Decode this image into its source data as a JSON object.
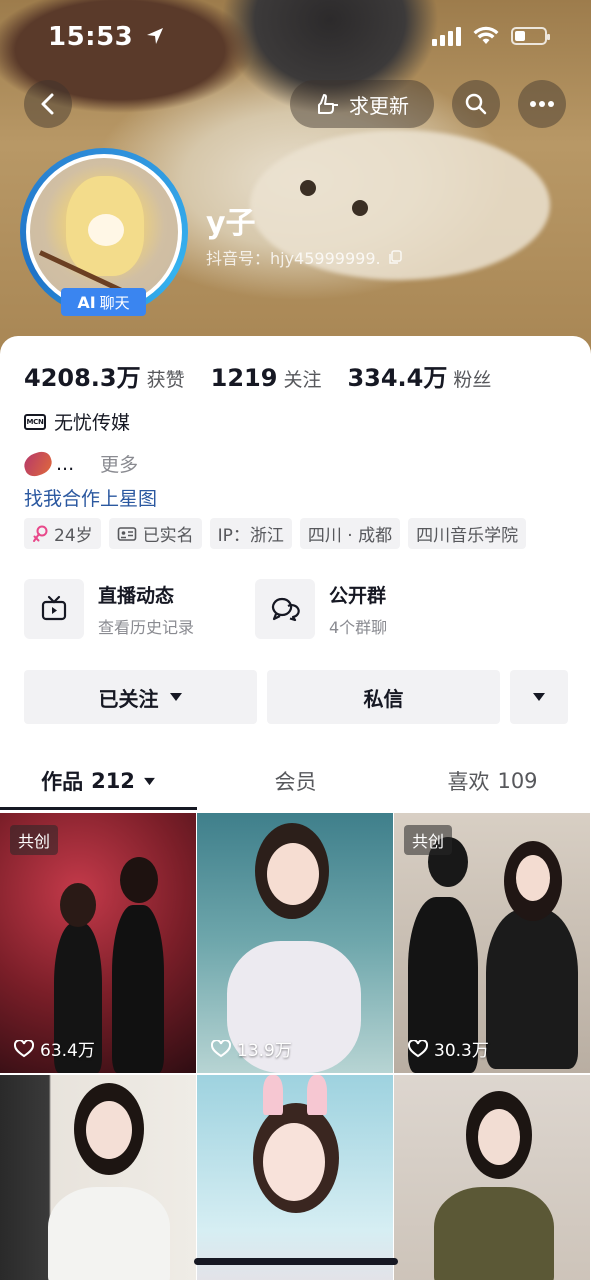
{
  "status_bar": {
    "time": "15:53"
  },
  "header": {
    "update_label": "求更新",
    "nickname": "y子",
    "douyin_id": "抖音号：hjy45999999.",
    "ai_badge": {
      "strong": "AI",
      "label": "聊天"
    }
  },
  "stats": [
    {
      "value": "4208.3万",
      "label": "获赞"
    },
    {
      "value": "1219",
      "label": "关注"
    },
    {
      "value": "334.4万",
      "label": "粉丝"
    }
  ],
  "mcn": {
    "icon_text": "MCN",
    "name": "无忧传媒"
  },
  "bio": {
    "ellipsis": "...",
    "more_label": "更多"
  },
  "cooperate_link": "找我合作上星图",
  "tags": [
    {
      "icon": "female-icon",
      "text": "24岁"
    },
    {
      "icon": "id-card-icon",
      "text": "已实名"
    },
    {
      "icon": "",
      "text": "IP：浙江"
    },
    {
      "icon": "",
      "text": "四川 · 成都"
    },
    {
      "icon": "",
      "text": "四川音乐学院"
    }
  ],
  "features": [
    {
      "icon": "tv-icon",
      "title": "直播动态",
      "subtitle": "查看历史记录"
    },
    {
      "icon": "chat-group-icon",
      "title": "公开群",
      "subtitle": "4个群聊"
    }
  ],
  "actions": {
    "follow_label": "已关注",
    "message_label": "私信"
  },
  "tabs": [
    {
      "label": "作品",
      "count": "212",
      "active": true
    },
    {
      "label": "会员",
      "count": "",
      "active": false
    },
    {
      "label": "喜欢",
      "count": "109",
      "active": false
    }
  ],
  "videos": [
    {
      "cochip": "共创",
      "likes": "63.4万"
    },
    {
      "cochip": "",
      "likes": "13.9万"
    },
    {
      "cochip": "共创",
      "likes": "30.3万"
    },
    {
      "cochip": "",
      "likes": ""
    },
    {
      "cochip": "",
      "likes": ""
    },
    {
      "cochip": "",
      "likes": ""
    }
  ],
  "colors": {
    "link": "#2b58a0",
    "ai_badge": "#3a85f0",
    "avatar_ring": "#2e8dd9"
  }
}
